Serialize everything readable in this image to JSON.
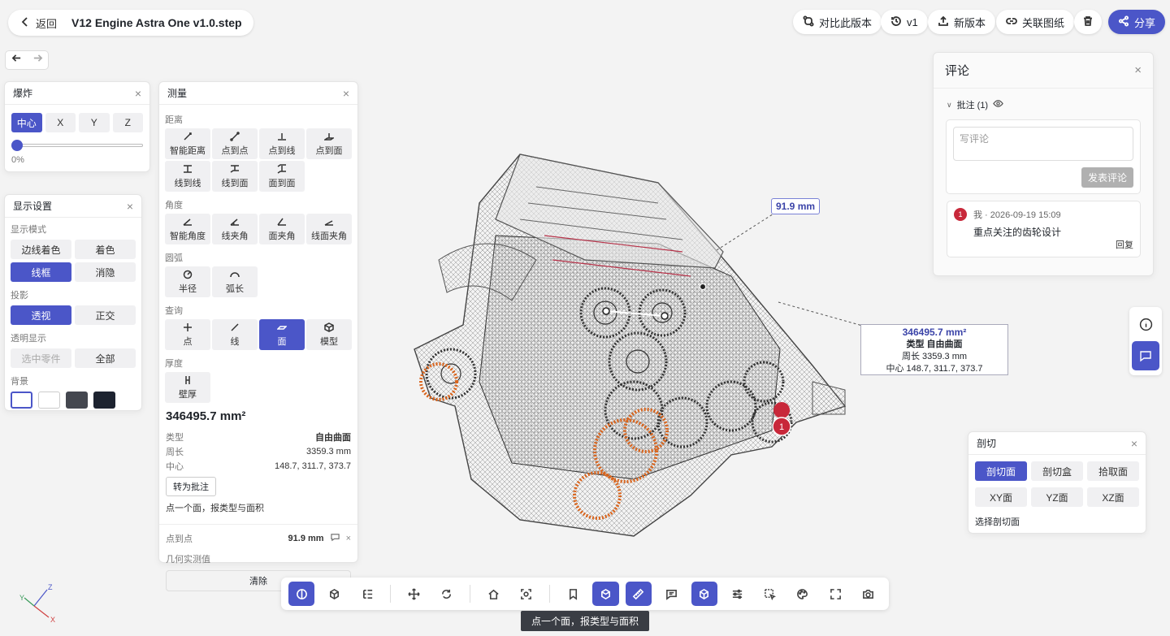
{
  "header": {
    "back_label": "返回",
    "file_title": "V12 Engine Astra One v1.0.step"
  },
  "top_actions": {
    "compare": "对比此版本",
    "version": "v1",
    "new_version": "新版本",
    "link": "关联图纸",
    "share": "分享"
  },
  "explode": {
    "title": "爆炸",
    "axes": [
      "中心",
      "X",
      "Y",
      "Z"
    ],
    "selected": "中心",
    "slider_value": 0,
    "slider_label": "0%"
  },
  "display": {
    "title": "显示设置",
    "mode_label": "显示模式",
    "modes": [
      "边线着色",
      "着色",
      "线框",
      "消隐"
    ],
    "mode_selected": "线框",
    "proj_label": "投影",
    "projections": [
      "透视",
      "正交"
    ],
    "proj_selected": "透视",
    "trans_label": "透明显示",
    "trans": [
      "选中零件",
      "全部"
    ],
    "bg_label": "背景",
    "bg_colors": [
      "#ffffff",
      "#ffffff",
      "#44474f",
      "#1d2330"
    ]
  },
  "measure": {
    "title": "测量",
    "distance_label": "距离",
    "distance": [
      "智能距离",
      "点到点",
      "点到线",
      "点到面",
      "线到线",
      "线到面",
      "面到面"
    ],
    "angle_label": "角度",
    "angle": [
      "智能角度",
      "线夹角",
      "面夹角",
      "线面夹角"
    ],
    "arc_label": "圆弧",
    "arc": [
      "半径",
      "弧长"
    ],
    "query_label": "查询",
    "query": [
      "点",
      "线",
      "面",
      "模型"
    ],
    "query_selected": "面",
    "thick_label": "厚度",
    "thick": [
      "壁厚"
    ],
    "result_area": "346495.7 mm²",
    "type_label": "类型",
    "type_value": "自由曲面",
    "perimeter_label": "周长",
    "perimeter_value": "3359.3 mm",
    "center_label": "中心",
    "center_value": "148.7, 311.7, 373.7",
    "to_annotation": "转为批注",
    "hint": "点一个面，报类型与面积",
    "p2p_label": "点到点",
    "p2p_value": "91.9 mm",
    "geom_label": "几何实测值",
    "clear": "清除"
  },
  "viewport": {
    "dim_label": "91.9 mm",
    "face_area": "346495.7 mm²",
    "face_type": "类型 自由曲面",
    "face_perim": "周长 3359.3 mm",
    "face_center": "中心 148.7, 311.7, 373.7",
    "marker": "1",
    "axis_labels": {
      "x": "X",
      "y": "Y",
      "z": "Z"
    }
  },
  "comments": {
    "title": "评论",
    "annot_label": "批注 (1)",
    "placeholder": "写评论",
    "post": "发表评论",
    "items": [
      {
        "num": "1",
        "meta": "我 · 2026-09-19 15:09",
        "text": "重点关注的齿轮设计",
        "reply": "回复"
      }
    ]
  },
  "section": {
    "title": "剖切",
    "modes": [
      "剖切面",
      "剖切盒",
      "拾取面"
    ],
    "selected": "剖切面",
    "planes": [
      "XY面",
      "YZ面",
      "XZ面"
    ],
    "hint": "选择剖切面"
  },
  "toolbar": {
    "tooltip": "点一个面，报类型与面积"
  },
  "colors": {
    "accent": "#4b56c8",
    "orange": "#d9641c",
    "marker": "#c8283a"
  }
}
